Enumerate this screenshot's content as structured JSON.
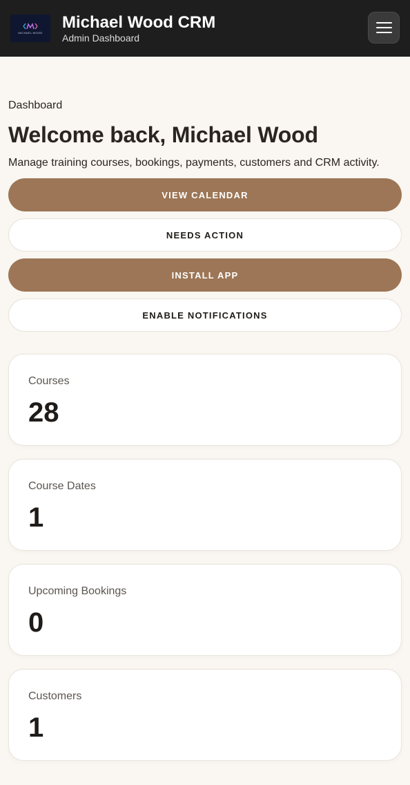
{
  "header": {
    "title": "Michael Wood CRM",
    "subtitle": "Admin Dashboard",
    "logo_text": "MICHAEL WOOD",
    "logo_icon": "mw-monogram-logo",
    "menu_icon": "hamburger-menu-icon"
  },
  "page": {
    "breadcrumb": "Dashboard",
    "title": "Welcome back, Michael Wood",
    "description": "Manage training courses, bookings, payments, customers and CRM activity."
  },
  "actions": [
    {
      "label": "VIEW CALENDAR",
      "style": "primary"
    },
    {
      "label": "NEEDS ACTION",
      "style": "secondary"
    },
    {
      "label": "INSTALL APP",
      "style": "primary"
    },
    {
      "label": "ENABLE NOTIFICATIONS",
      "style": "secondary"
    }
  ],
  "stats": [
    {
      "label": "Courses",
      "value": "28"
    },
    {
      "label": "Course Dates",
      "value": "1"
    },
    {
      "label": "Upcoming Bookings",
      "value": "0"
    },
    {
      "label": "Customers",
      "value": "1"
    }
  ],
  "colors": {
    "header_bg": "#1e1e1e",
    "page_bg": "#faf6f1",
    "accent": "#9c7656"
  }
}
